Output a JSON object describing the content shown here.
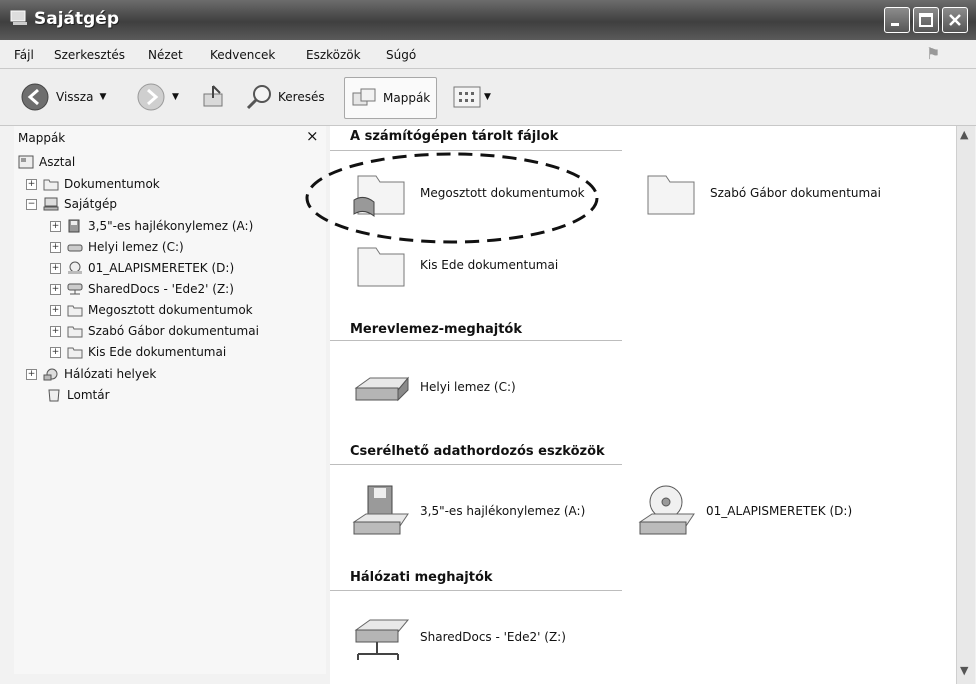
{
  "window": {
    "title": "Sajátgép"
  },
  "menu": [
    "Fájl",
    "Szerkesztés",
    "Nézet",
    "Kedvencek",
    "Eszközök",
    "Súgó"
  ],
  "toolbar": {
    "back": "Vissza",
    "search": "Keresés",
    "folders": "Mappák"
  },
  "leftpane": {
    "header": "Mappák",
    "close": "×",
    "tree": [
      {
        "label": "Asztal"
      },
      {
        "label": "Dokumentumok"
      },
      {
        "label": "Sajátgép"
      },
      {
        "label": "3,5\"-es hajlékonylemez (A:)"
      },
      {
        "label": "Helyi lemez (C:)"
      },
      {
        "label": "01_ALAPISMERETEK (D:)"
      },
      {
        "label": "SharedDocs - 'Ede2' (Z:)"
      },
      {
        "label": "Megosztott dokumentumok"
      },
      {
        "label": "Szabó Gábor dokumentumai"
      },
      {
        "label": "Kis Ede dokumentumai"
      },
      {
        "label": "Hálózati helyek"
      },
      {
        "label": "Lomtár"
      }
    ]
  },
  "main": {
    "groups": [
      {
        "title": "A számítógépen tárolt fájlok",
        "items": [
          "Megosztott dokumentumok",
          "Szabó Gábor dokumentumai",
          "Kis Ede dokumentumai"
        ]
      },
      {
        "title": "Merevlemez-meghajtók",
        "items": [
          "Helyi lemez (C:)"
        ]
      },
      {
        "title": "Cserélhető adathordozós eszközök",
        "items": [
          "3,5\"-es hajlékonylemez (A:)",
          "01_ALAPISMERETEK (D:)"
        ]
      },
      {
        "title": "Hálózati meghajtók",
        "items": [
          "SharedDocs - 'Ede2' (Z:)"
        ]
      }
    ]
  }
}
